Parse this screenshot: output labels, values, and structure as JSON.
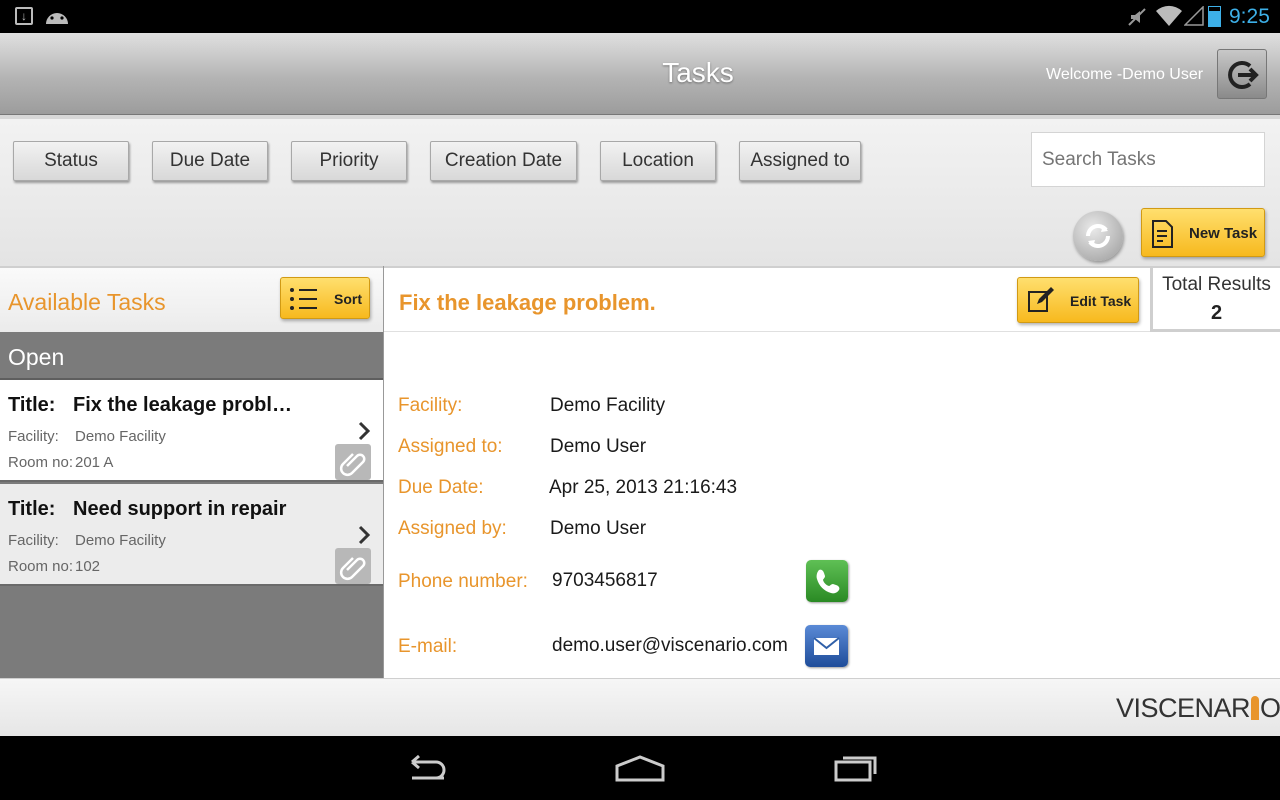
{
  "status_bar": {
    "time": "9:25"
  },
  "header": {
    "title": "Tasks",
    "welcome": "Welcome -Demo User"
  },
  "filters": [
    "Status",
    "Due Date",
    "Priority",
    "Creation Date",
    "Location",
    "Assigned to"
  ],
  "search": {
    "placeholder": "Search Tasks"
  },
  "actions": {
    "new_task": "New Task",
    "sort": "Sort",
    "edit_task": "Edit Task"
  },
  "left_panel": {
    "heading": "Available Tasks",
    "group": "Open",
    "tasks": [
      {
        "title_label": "Title:",
        "title": "Fix the leakage probl…",
        "facility_label": "Facility:",
        "facility": "Demo Facility",
        "room_label": "Room no:",
        "room": "201 A"
      },
      {
        "title_label": "Title:",
        "title": "Need support in repair",
        "facility_label": "Facility:",
        "facility": "Demo Facility",
        "room_label": "Room no:",
        "room": "102"
      }
    ]
  },
  "detail": {
    "title": "Fix the leakage problem.",
    "total_results_label": "Total Results",
    "total_results": "2",
    "fields": {
      "facility_label": "Facility:",
      "facility": "Demo Facility",
      "assigned_to_label": "Assigned to:",
      "assigned_to": "Demo User",
      "due_date_label": "Due Date:",
      "due_date": "Apr 25, 2013 21:16:43",
      "assigned_by_label": "Assigned by:",
      "assigned_by": "Demo User",
      "phone_label": "Phone number:",
      "phone": "9703456817",
      "email_label": "E-mail:",
      "email": "demo.user@viscenario.com"
    }
  },
  "brand": {
    "logo_left": "VISCENAR",
    "logo_right": "O"
  },
  "colors": {
    "accent": "#e8952c",
    "button_yellow": "#f7c232",
    "phone_green": "#3a9a32",
    "mail_blue": "#2f5fa8"
  }
}
